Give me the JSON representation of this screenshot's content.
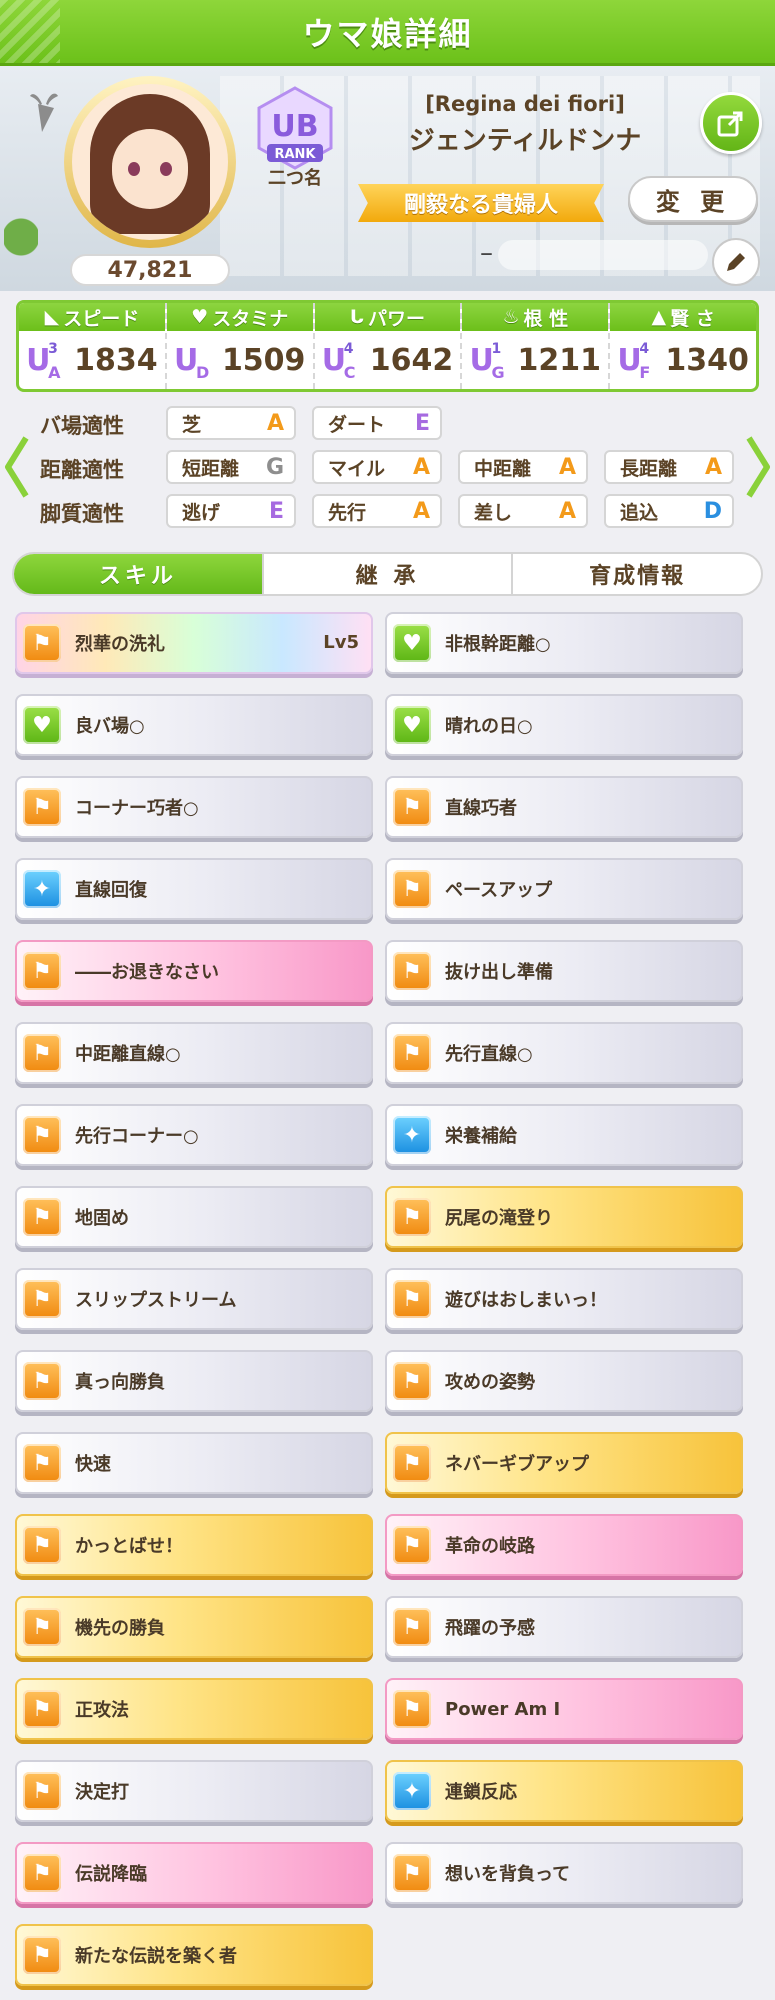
{
  "header": {
    "title": "ウマ娘詳細"
  },
  "profile": {
    "title_en": "[Regina dei fiori]",
    "name": "ジェンティルドンナ",
    "fans": "47,821",
    "rank_label": "二つ名",
    "rank_badge": "UB",
    "rank_text": "RANK",
    "epithet": "剛毅なる貴婦人",
    "support_value": "–",
    "change_label": "変 更",
    "icons": [
      "carrot-icon",
      "share-icon",
      "pencil-icon"
    ]
  },
  "stats": [
    {
      "label": "スピード",
      "icon": "shoe-icon",
      "rank": "UA",
      "sup": "3",
      "value": "1834"
    },
    {
      "label": "スタミナ",
      "icon": "heart-icon",
      "rank": "UD",
      "sup": "",
      "value": "1509"
    },
    {
      "label": "パワー",
      "icon": "arm-icon",
      "rank": "UC",
      "sup": "4",
      "value": "1642"
    },
    {
      "label": "根 性",
      "icon": "flame-icon",
      "rank": "UG",
      "sup": "1",
      "value": "1211"
    },
    {
      "label": "賢 さ",
      "icon": "cap-icon",
      "rank": "UF",
      "sup": "4",
      "value": "1340"
    }
  ],
  "aptitude": {
    "rows": [
      {
        "label": "バ場適性",
        "items": [
          {
            "name": "芝",
            "grade": "A"
          },
          {
            "name": "ダート",
            "grade": "E"
          }
        ]
      },
      {
        "label": "距離適性",
        "items": [
          {
            "name": "短距離",
            "grade": "G"
          },
          {
            "name": "マイル",
            "grade": "A"
          },
          {
            "name": "中距離",
            "grade": "A"
          },
          {
            "name": "長距離",
            "grade": "A"
          }
        ]
      },
      {
        "label": "脚質適性",
        "items": [
          {
            "name": "逃げ",
            "grade": "E"
          },
          {
            "name": "先行",
            "grade": "A"
          },
          {
            "name": "差し",
            "grade": "A"
          },
          {
            "name": "追込",
            "grade": "D"
          }
        ]
      }
    ],
    "grade_colors": {
      "A": "#f39a1a",
      "E": "#a66ae0",
      "G": "#8e8e8e",
      "D": "#2a8fe0"
    }
  },
  "tabs": [
    {
      "label": "スキル",
      "active": true
    },
    {
      "label": "継 承",
      "active": false
    },
    {
      "label": "育成情報",
      "active": false
    }
  ],
  "skills": [
    {
      "name": "烈華の洗礼",
      "style": "rainbow",
      "icon": "orange",
      "lv": "Lv5"
    },
    {
      "name": "非根幹距離○",
      "style": "white",
      "icon": "green"
    },
    {
      "name": "良バ場○",
      "style": "white",
      "icon": "green"
    },
    {
      "name": "晴れの日○",
      "style": "white",
      "icon": "green"
    },
    {
      "name": "コーナー巧者○",
      "style": "white",
      "icon": "orange"
    },
    {
      "name": "直線巧者",
      "style": "white",
      "icon": "orange"
    },
    {
      "name": "直線回復",
      "style": "white",
      "icon": "blue"
    },
    {
      "name": "ペースアップ",
      "style": "white",
      "icon": "orange"
    },
    {
      "name": "――お退きなさい",
      "style": "pink",
      "icon": "orange"
    },
    {
      "name": "抜け出し準備",
      "style": "white",
      "icon": "orange"
    },
    {
      "name": "中距離直線○",
      "style": "white",
      "icon": "orange"
    },
    {
      "name": "先行直線○",
      "style": "white",
      "icon": "orange"
    },
    {
      "name": "先行コーナー○",
      "style": "white",
      "icon": "orange"
    },
    {
      "name": "栄養補給",
      "style": "white",
      "icon": "blue"
    },
    {
      "name": "地固め",
      "style": "white",
      "icon": "orange"
    },
    {
      "name": "尻尾の滝登り",
      "style": "gold",
      "icon": "orange"
    },
    {
      "name": "スリップストリーム",
      "style": "white",
      "icon": "orange"
    },
    {
      "name": "遊びはおしまいっ！",
      "style": "white",
      "icon": "orange"
    },
    {
      "name": "真っ向勝負",
      "style": "white",
      "icon": "orange"
    },
    {
      "name": "攻めの姿勢",
      "style": "white",
      "icon": "orange"
    },
    {
      "name": "快速",
      "style": "white",
      "icon": "orange"
    },
    {
      "name": "ネバーギブアップ",
      "style": "gold",
      "icon": "orange"
    },
    {
      "name": "かっとばせ！",
      "style": "gold",
      "icon": "orange"
    },
    {
      "name": "革命の岐路",
      "style": "pink",
      "icon": "orange"
    },
    {
      "name": "機先の勝負",
      "style": "gold",
      "icon": "orange"
    },
    {
      "name": "飛躍の予感",
      "style": "white",
      "icon": "orange"
    },
    {
      "name": "正攻法",
      "style": "gold",
      "icon": "orange"
    },
    {
      "name": "Power Am I",
      "style": "pink",
      "icon": "orange"
    },
    {
      "name": "決定打",
      "style": "white",
      "icon": "orange"
    },
    {
      "name": "連鎖反応",
      "style": "gold",
      "icon": "blue"
    },
    {
      "name": "伝説降臨",
      "style": "pink",
      "icon": "orange"
    },
    {
      "name": "想いを背負って",
      "style": "white",
      "icon": "orange"
    },
    {
      "name": "新たな伝説を築く者",
      "style": "gold",
      "icon": "orange"
    }
  ]
}
